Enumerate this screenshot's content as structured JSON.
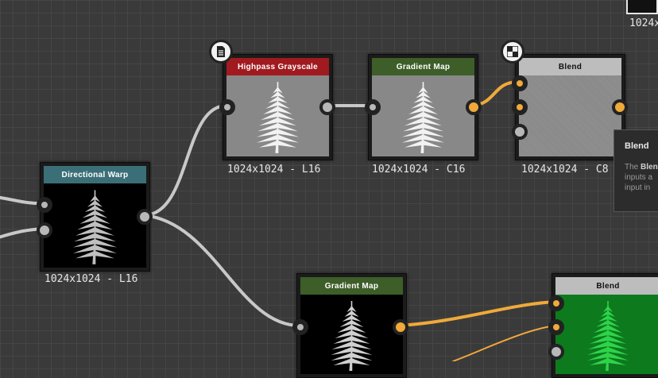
{
  "nodes": {
    "directional_warp": {
      "title": "Directional Warp",
      "resolution": "1024x1024 - L16",
      "header_color": "#3b6f78"
    },
    "highpass": {
      "title": "Highpass Grayscale",
      "resolution": "1024x1024 - L16",
      "header_color": "#a01a1f"
    },
    "gradient_map_top": {
      "title": "Gradient Map",
      "resolution": "1024x1024 - C16",
      "header_color": "#3d5e28"
    },
    "blend_top": {
      "title": "Blend",
      "resolution": "1024x1024 - C8",
      "header_color": "#bdbdbd"
    },
    "gradient_map_bottom": {
      "title": "Gradient Map",
      "header_color": "#3d5e28"
    },
    "blend_bottom": {
      "title": "Blend",
      "header_color": "#bdbdbd"
    }
  },
  "corner": {
    "resolution": "1024x"
  },
  "tooltip": {
    "title": "Blend",
    "line1_prefix": "The ",
    "line1_bold": "Blen",
    "line2": "inputs a",
    "line3": "input in"
  },
  "colors": {
    "wire_gray": "#c8c8c8",
    "wire_orange": "#f0a93a",
    "port_gray": "#b8b8b8",
    "port_orange": "#f0a93a",
    "blend_green": "#0d7a1e"
  },
  "icons": {
    "highpass_badge": "document-icon",
    "blend_badge": "checker-icon"
  }
}
